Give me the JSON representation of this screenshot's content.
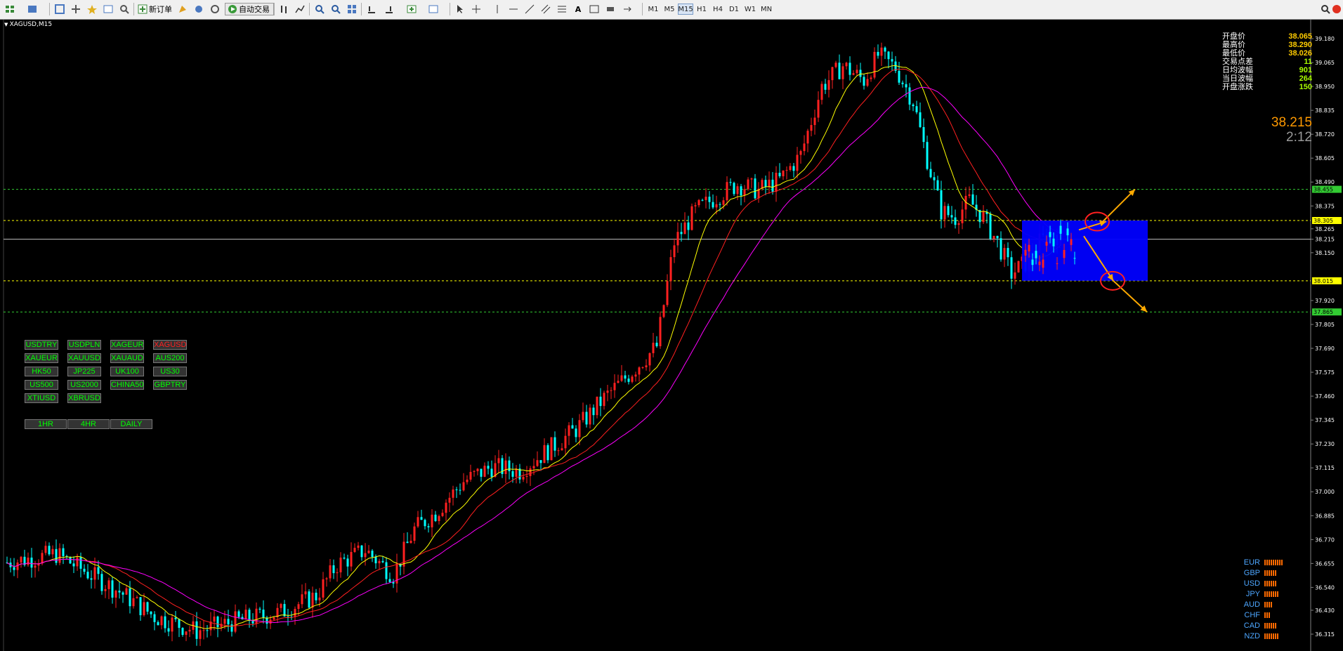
{
  "toolbar": {
    "new_order_label": "新订单",
    "autotrade_label": "自动交易",
    "timeframes": [
      "M1",
      "M5",
      "M15",
      "H1",
      "H4",
      "D1",
      "W1",
      "MN"
    ],
    "active_timeframe": "M15"
  },
  "chart": {
    "symbol_label": "XAGUSD,M15",
    "price_axis_labels": [
      "39.180",
      "39.065",
      "38.950",
      "38.835",
      "38.720",
      "38.605",
      "38.490",
      "38.455",
      "38.375",
      "38.305",
      "38.265",
      "38.215",
      "38.150",
      "38.015",
      "37.920",
      "37.865",
      "37.805",
      "37.690",
      "37.575",
      "37.460",
      "37.345",
      "37.230",
      "37.115",
      "37.000",
      "36.885",
      "36.770",
      "36.655",
      "36.540",
      "36.430",
      "36.315"
    ],
    "hlines": [
      {
        "price": "38.455",
        "color": "#33cc33"
      },
      {
        "price": "38.305",
        "color": "#ffff00"
      },
      {
        "price": "38.215",
        "color": "#c0c0c0"
      },
      {
        "price": "38.015",
        "color": "#ffff00"
      },
      {
        "price": "37.865",
        "color": "#33cc33"
      }
    ],
    "colors": {
      "bull": "#ff2020",
      "bear": "#00ffff",
      "ma_fast": "#ffff00",
      "ma_mid": "#ff2020",
      "ma_slow": "#ff00ff",
      "zone": "#0000ff",
      "arrow": "#ffaa00",
      "circle": "#ff2020"
    }
  },
  "pair_buttons": [
    [
      "USDTRY",
      "USDPLN",
      "XAGEUR",
      "XAGUSD"
    ],
    [
      "XAUEUR",
      "XAUUSD",
      "XAUAUD",
      "AUS200"
    ],
    [
      "HK50",
      "JP225",
      "UK100",
      "US30"
    ],
    [
      "US500",
      "US2000",
      "CHINA50",
      "GBPTRY"
    ],
    [
      "XTIUSD",
      "XBRUSD"
    ]
  ],
  "selected_pair": "XAGUSD",
  "period_buttons": [
    "1HR",
    "4HR",
    "DAILY"
  ],
  "info_panel": [
    {
      "label": "开盘价",
      "value": "38.065"
    },
    {
      "label": "最高价",
      "value": "38.290"
    },
    {
      "label": "最低价",
      "value": "38.026"
    },
    {
      "label": "交易点差",
      "value": "11"
    },
    {
      "label": "日均波幅",
      "value": "901"
    },
    {
      "label": "当日波幅",
      "value": "264"
    },
    {
      "label": "开盘涨跌",
      "value": "150"
    }
  ],
  "bid_price": "38.215",
  "bar_timer": "2:12",
  "currency_strength": [
    {
      "currency": "EUR",
      "level": 9
    },
    {
      "currency": "GBP",
      "level": 6
    },
    {
      "currency": "USD",
      "level": 6
    },
    {
      "currency": "JPY",
      "level": 7
    },
    {
      "currency": "AUD",
      "level": 4
    },
    {
      "currency": "CHF",
      "level": 3
    },
    {
      "currency": "CAD",
      "level": 6
    },
    {
      "currency": "NZD",
      "level": 7
    }
  ]
}
